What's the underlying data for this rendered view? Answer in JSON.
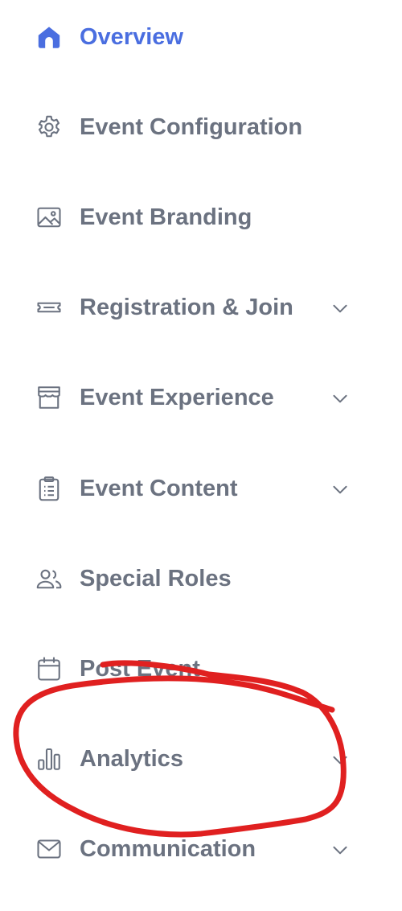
{
  "colors": {
    "active": "#4a6ee0",
    "text": "#6b7280",
    "icon": "#6b7280",
    "annotation": "#e02020"
  },
  "sidebar": {
    "items": [
      {
        "label": "Overview",
        "icon": "home-icon",
        "active": true,
        "expandable": false
      },
      {
        "label": "Event Configuration",
        "icon": "gear-icon",
        "active": false,
        "expandable": false
      },
      {
        "label": "Event Branding",
        "icon": "image-icon",
        "active": false,
        "expandable": false
      },
      {
        "label": "Registration & Join",
        "icon": "ticket-icon",
        "active": false,
        "expandable": true
      },
      {
        "label": "Event Experience",
        "icon": "storefront-icon",
        "active": false,
        "expandable": true
      },
      {
        "label": "Event Content",
        "icon": "clipboard-icon",
        "active": false,
        "expandable": true
      },
      {
        "label": "Special Roles",
        "icon": "users-icon",
        "active": false,
        "expandable": false
      },
      {
        "label": "Post Event",
        "icon": "calendar-icon",
        "active": false,
        "expandable": false
      },
      {
        "label": "Analytics",
        "icon": "bar-chart-icon",
        "active": false,
        "expandable": true
      },
      {
        "label": "Communication",
        "icon": "mail-icon",
        "active": false,
        "expandable": true
      }
    ]
  }
}
